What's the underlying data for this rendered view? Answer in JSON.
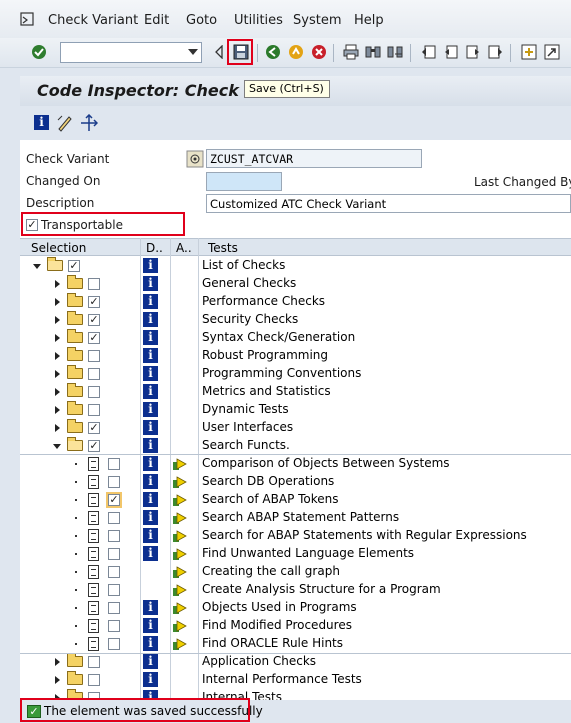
{
  "menu": {
    "items": [
      "Check Variant",
      "Edit",
      "Goto",
      "Utilities",
      "System",
      "Help"
    ]
  },
  "toolbar": {
    "command_value": "",
    "tooltip": "Save   (Ctrl+S)"
  },
  "title": "Code Inspector: Check V",
  "form": {
    "check_variant_label": "Check Variant",
    "check_variant_value": "ZCUST_ATCVAR",
    "changed_on_label": "Changed On",
    "changed_on_value": "",
    "last_changed_by_label": "Last Changed By",
    "description_label": "Description",
    "description_value": "Customized ATC Check Variant",
    "transportable_label": "Transportable",
    "transportable_checked": true
  },
  "table": {
    "headers": [
      "Selection",
      "D..",
      "A..",
      "Tests"
    ],
    "rows": [
      {
        "label": "List of Checks",
        "level": 0,
        "kind": "folder-open",
        "checked": true,
        "info": true,
        "exec": false
      },
      {
        "label": "General Checks",
        "level": 1,
        "kind": "folder",
        "checked": false,
        "info": true,
        "exec": false
      },
      {
        "label": "Performance Checks",
        "level": 1,
        "kind": "folder",
        "checked": true,
        "info": true,
        "exec": false
      },
      {
        "label": "Security Checks",
        "level": 1,
        "kind": "folder",
        "checked": true,
        "info": true,
        "exec": false
      },
      {
        "label": "Syntax Check/Generation",
        "level": 1,
        "kind": "folder",
        "checked": true,
        "info": true,
        "exec": false
      },
      {
        "label": "Robust Programming",
        "level": 1,
        "kind": "folder",
        "checked": false,
        "info": true,
        "exec": false
      },
      {
        "label": "Programming Conventions",
        "level": 1,
        "kind": "folder",
        "checked": false,
        "info": true,
        "exec": false
      },
      {
        "label": "Metrics and Statistics",
        "level": 1,
        "kind": "folder",
        "checked": false,
        "info": true,
        "exec": false
      },
      {
        "label": "Dynamic Tests",
        "level": 1,
        "kind": "folder",
        "checked": false,
        "info": true,
        "exec": false
      },
      {
        "label": "User Interfaces",
        "level": 1,
        "kind": "folder",
        "checked": true,
        "info": true,
        "exec": false
      },
      {
        "label": "Search Functs.",
        "level": 1,
        "kind": "folder-open",
        "checked": true,
        "info": true,
        "exec": false
      },
      {
        "label": "Comparison of Objects Between Systems",
        "level": 2,
        "kind": "doc",
        "checked": false,
        "info": true,
        "exec": true
      },
      {
        "label": "Search DB Operations",
        "level": 2,
        "kind": "doc",
        "checked": false,
        "info": true,
        "exec": true
      },
      {
        "label": "Search of ABAP Tokens",
        "level": 2,
        "kind": "doc",
        "checked": true,
        "info": true,
        "exec": true
      },
      {
        "label": "Search ABAP Statement Patterns",
        "level": 2,
        "kind": "doc",
        "checked": false,
        "info": true,
        "exec": true
      },
      {
        "label": "Search for ABAP Statements with Regular Expressions",
        "level": 2,
        "kind": "doc",
        "checked": false,
        "info": true,
        "exec": true
      },
      {
        "label": "Find Unwanted Language Elements",
        "level": 2,
        "kind": "doc",
        "checked": false,
        "info": true,
        "exec": true
      },
      {
        "label": "Creating the call graph",
        "level": 2,
        "kind": "doc",
        "checked": false,
        "info": false,
        "exec": true
      },
      {
        "label": "Create Analysis Structure for a Program",
        "level": 2,
        "kind": "doc",
        "checked": false,
        "info": false,
        "exec": true
      },
      {
        "label": "Objects Used in Programs",
        "level": 2,
        "kind": "doc",
        "checked": false,
        "info": true,
        "exec": true
      },
      {
        "label": "Find Modified Procedures",
        "level": 2,
        "kind": "doc",
        "checked": false,
        "info": true,
        "exec": true
      },
      {
        "label": "Find ORACLE Rule Hints",
        "level": 2,
        "kind": "doc",
        "checked": false,
        "info": true,
        "exec": true
      },
      {
        "label": "Application Checks",
        "level": 1,
        "kind": "folder",
        "checked": false,
        "info": true,
        "exec": false
      },
      {
        "label": "Internal Performance Tests",
        "level": 1,
        "kind": "folder",
        "checked": false,
        "info": true,
        "exec": false
      },
      {
        "label": "Internal Tests",
        "level": 1,
        "kind": "folder",
        "checked": false,
        "info": true,
        "exec": false
      }
    ]
  },
  "status": {
    "message": "The element was saved successfully"
  }
}
